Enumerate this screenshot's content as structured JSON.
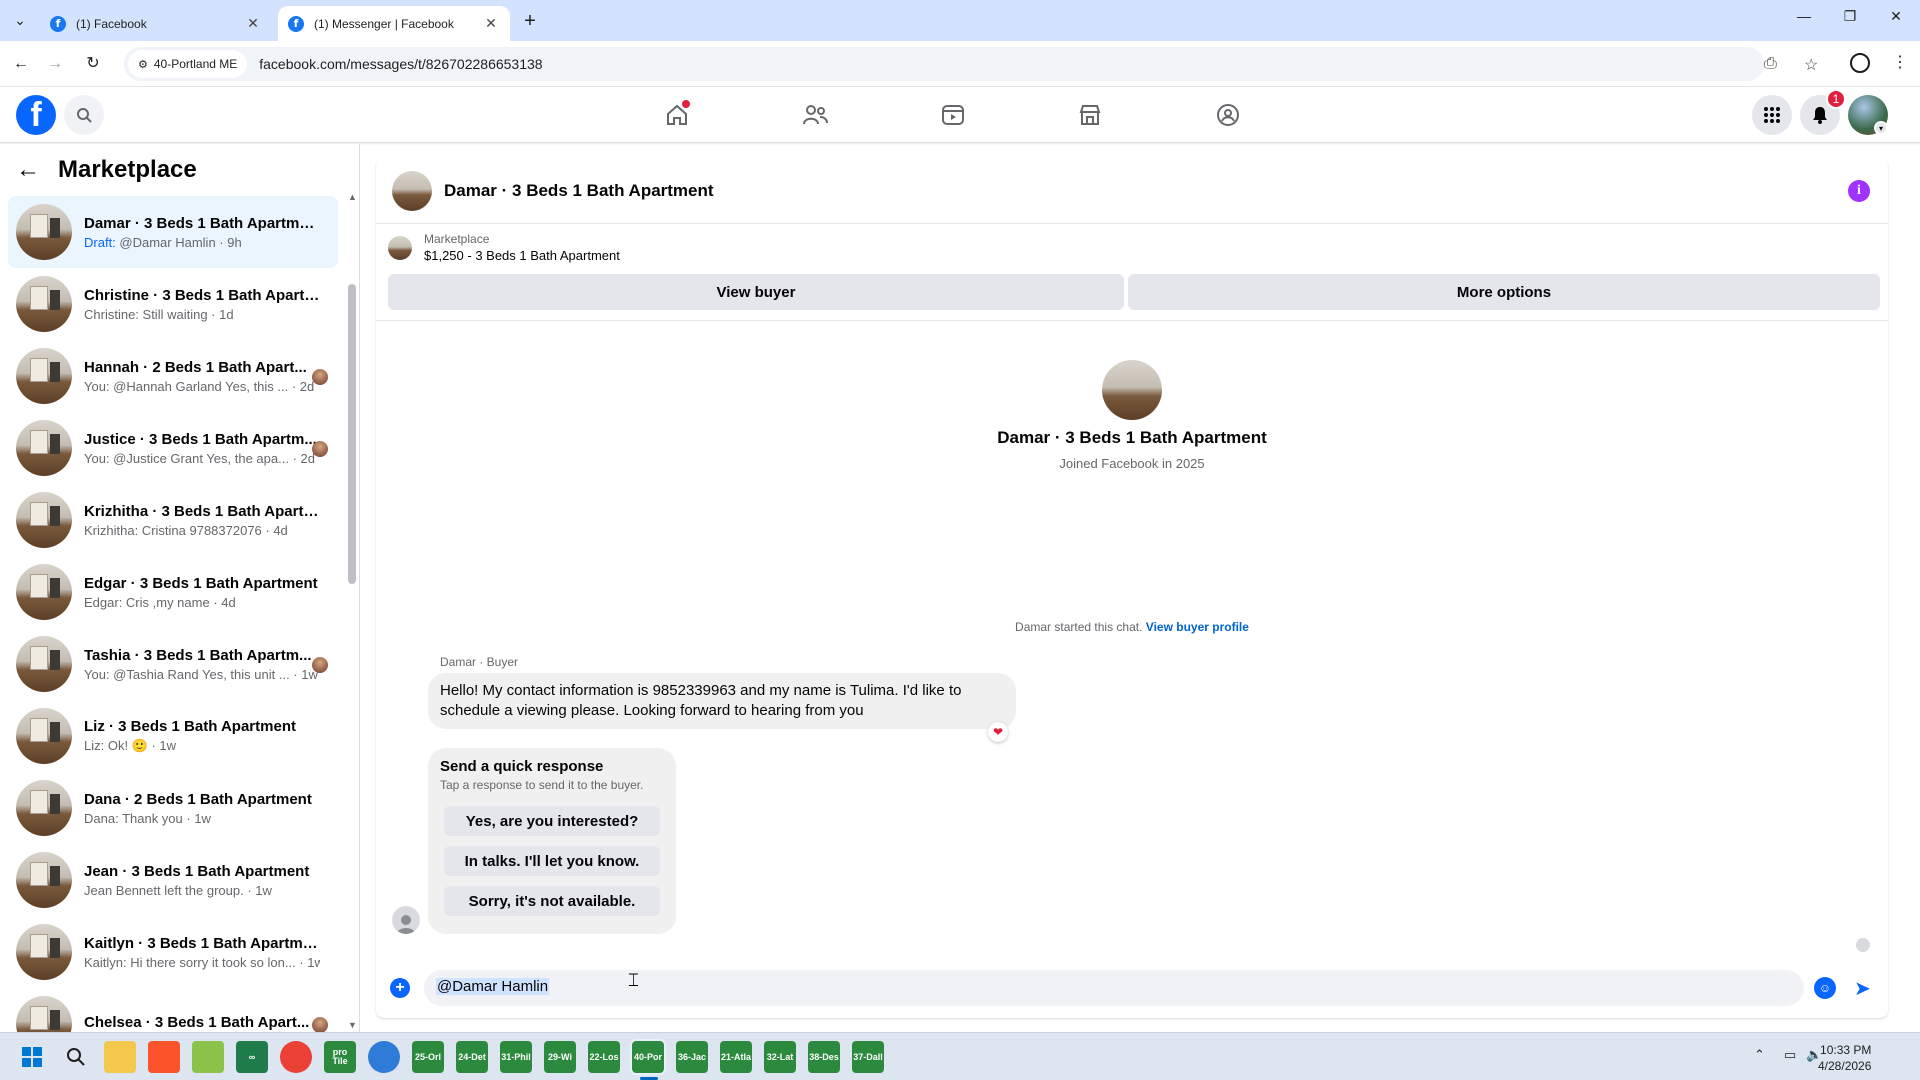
{
  "browser": {
    "tabs": [
      {
        "title": "(1) Facebook",
        "active": false
      },
      {
        "title": "(1) Messenger | Facebook",
        "active": true
      }
    ],
    "site_chip": "40-Portland ME",
    "url": "facebook.com/messages/t/826702286653138"
  },
  "fb": {
    "notifications_count": "1",
    "accent": "#0866ff"
  },
  "sidebar": {
    "title": "Marketplace",
    "conversations": [
      {
        "name": "Damar · 3 Beds 1 Bath Apartment",
        "draft": "Draft:",
        "preview": " @Damar Hamlin · 9h"
      },
      {
        "name": "Christine · 3 Beds 1 Bath Apartm...",
        "preview": "Christine: Still waiting · 1d"
      },
      {
        "name": "Hannah · 2 Beds 1 Bath Apart...",
        "preview": "You: @Hannah Garland Yes, this ... · 2d"
      },
      {
        "name": "Justice · 3 Beds 1 Bath Apartm...",
        "preview": "You: @Justice Grant Yes, the apa... · 2d"
      },
      {
        "name": "Krizhitha · 3 Beds 1 Bath Apartm...",
        "preview": "Krizhitha: Cristina 9788372076 · 4d"
      },
      {
        "name": "Edgar · 3 Beds 1 Bath Apartment",
        "preview": "Edgar: Cris ,my name · 4d"
      },
      {
        "name": "Tashia · 3 Beds 1 Bath Apartm...",
        "preview": "You: @Tashia Rand Yes, this unit ... · 1w"
      },
      {
        "name": "Liz · 3 Beds 1 Bath Apartment",
        "preview": "Liz: Ok! 🙂 · 1w"
      },
      {
        "name": "Dana · 2 Beds 1 Bath Apartment",
        "preview": "Dana: Thank you · 1w"
      },
      {
        "name": "Jean · 3 Beds 1 Bath Apartment",
        "preview": "Jean Bennett left the group. · 1w"
      },
      {
        "name": "Kaitlyn · 3 Beds 1 Bath Apartment",
        "preview": "Kaitlyn: Hi there sorry it took so lon... · 1w"
      },
      {
        "name": "Chelsea · 3 Beds 1 Bath Apart...",
        "preview": ""
      }
    ]
  },
  "chat": {
    "title": "Damar · 3 Beds 1 Bath Apartment",
    "listing_label": "Marketplace",
    "listing_detail": "$1,250 - 3 Beds 1 Bath Apartment",
    "view_buyer": "View buyer",
    "more_options": "More options",
    "profile_name": "Damar · 3 Beds 1 Bath Apartment",
    "joined": "Joined Facebook in 2025",
    "started_text": "Damar started this chat.",
    "started_link": "View buyer profile",
    "sender_label": "Damar · Buyer",
    "message": "Hello! My contact information is 9852339963 and my name is Tulima. I'd like to schedule a viewing please. Looking forward to hearing from you",
    "quick_title": "Send a quick response",
    "quick_sub": "Tap a response to send it to the buyer.",
    "quick_responses": [
      "Yes, are you interested?",
      "In talks. I'll let you know.",
      "Sorry, it's not available."
    ],
    "composer_value": "@Damar Hamlin"
  },
  "taskbar": {
    "items": [
      "25-Orl",
      "24-Det",
      "31-Phil",
      "29-Wi",
      "22-Los",
      "40-Por",
      "36-Jac",
      "21-Atla",
      "32-Lat",
      "38-Des",
      "37-Dall"
    ],
    "pro_tile": "pro Tile",
    "time": "10:33 PM",
    "date": "4/28/2026"
  }
}
